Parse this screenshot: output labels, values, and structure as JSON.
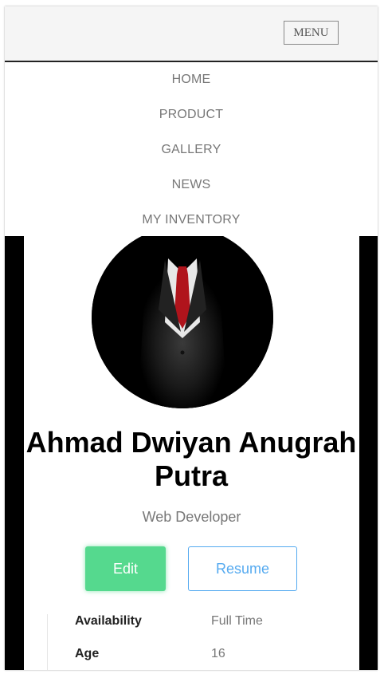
{
  "header": {
    "menu_label": "MENU"
  },
  "nav": {
    "items": [
      {
        "label": "HOME"
      },
      {
        "label": "PRODUCT"
      },
      {
        "label": "GALLERY"
      },
      {
        "label": "NEWS"
      },
      {
        "label": "MY INVENTORY"
      }
    ]
  },
  "profile": {
    "name": "Ahmad Dwiyan Anugrah Putra",
    "role": "Web Developer",
    "edit_label": "Edit",
    "resume_label": "Resume",
    "details": [
      {
        "key": "Availability",
        "value": "Full Time"
      },
      {
        "key": "Age",
        "value": "16"
      }
    ]
  },
  "colors": {
    "edit_button": "#55d98e",
    "resume_button": "#55aaf0",
    "background": "#000000"
  }
}
